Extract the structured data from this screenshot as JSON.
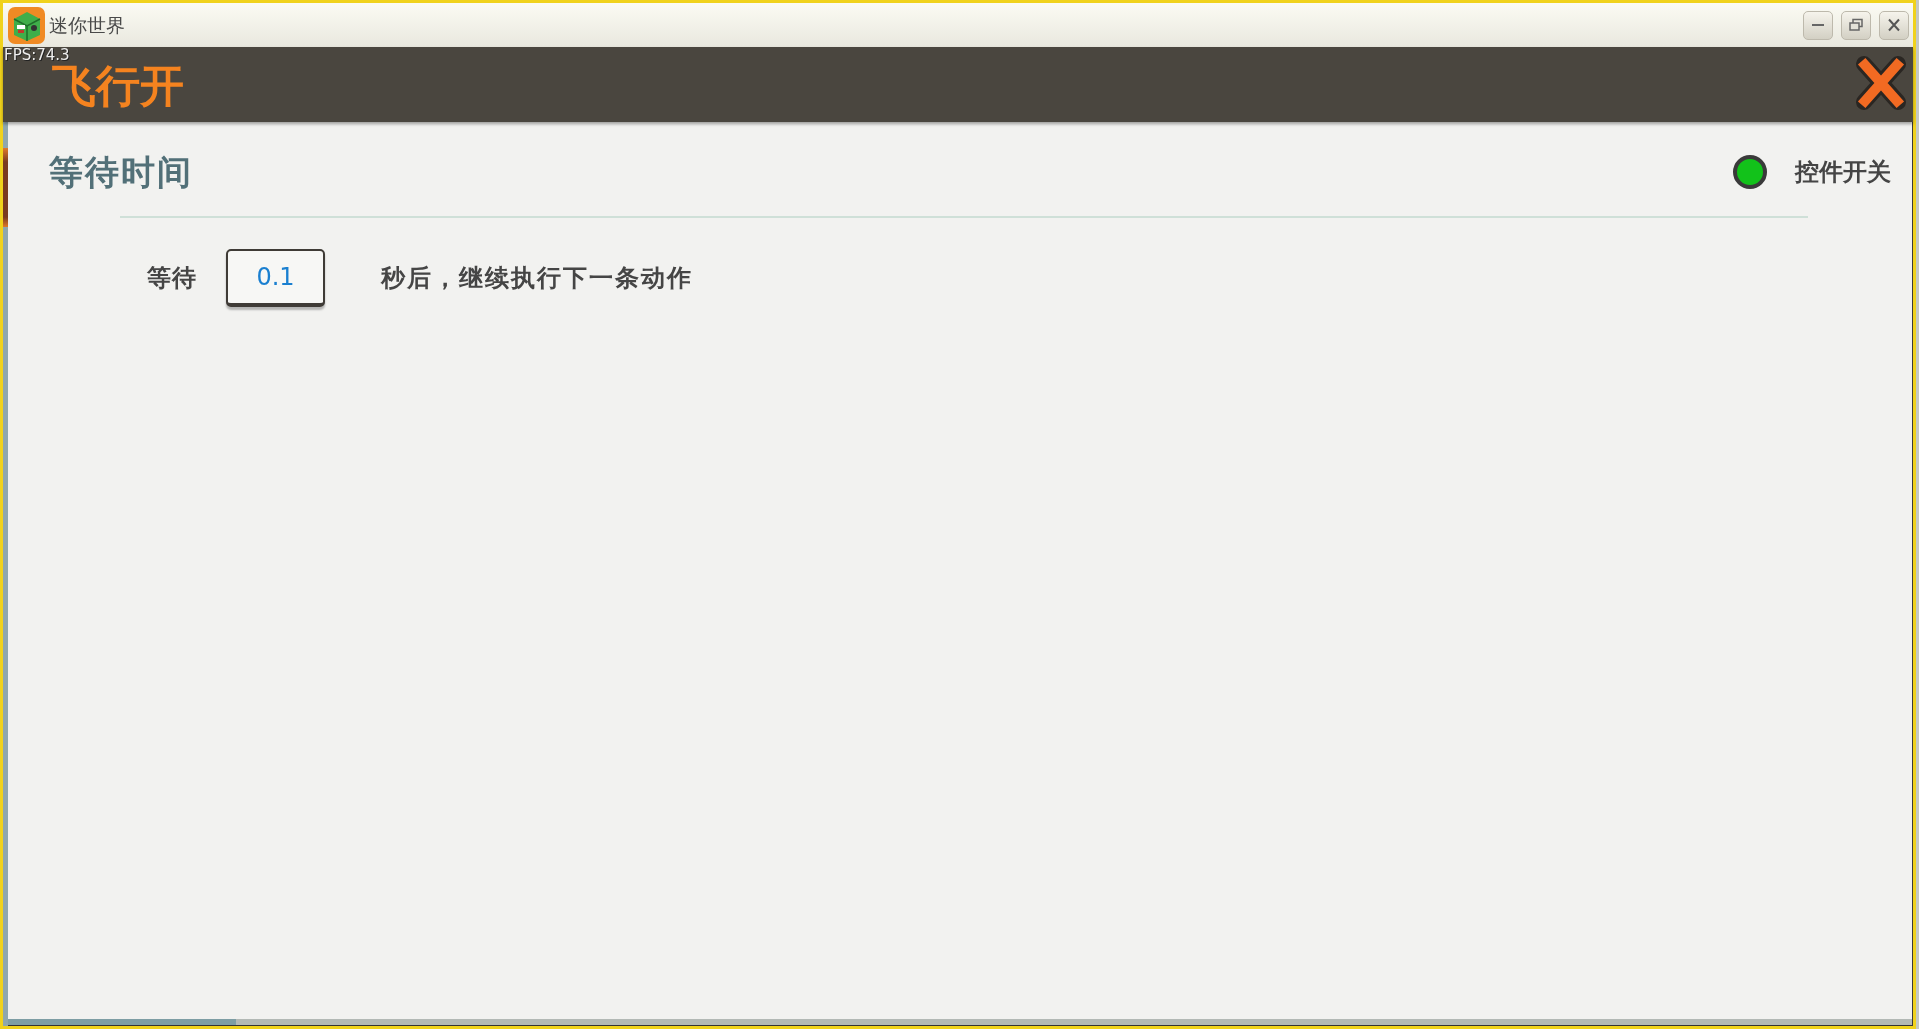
{
  "window": {
    "title": "迷你世界"
  },
  "overlay": {
    "fps": "FPS:74.3"
  },
  "header": {
    "title": "飞行开"
  },
  "section": {
    "title": "等待时间",
    "toggle": {
      "label": "控件开关",
      "on": true
    }
  },
  "wait_row": {
    "label": "等待",
    "value": "0.1",
    "suffix": "秒后，继续执行下一条动作"
  }
}
